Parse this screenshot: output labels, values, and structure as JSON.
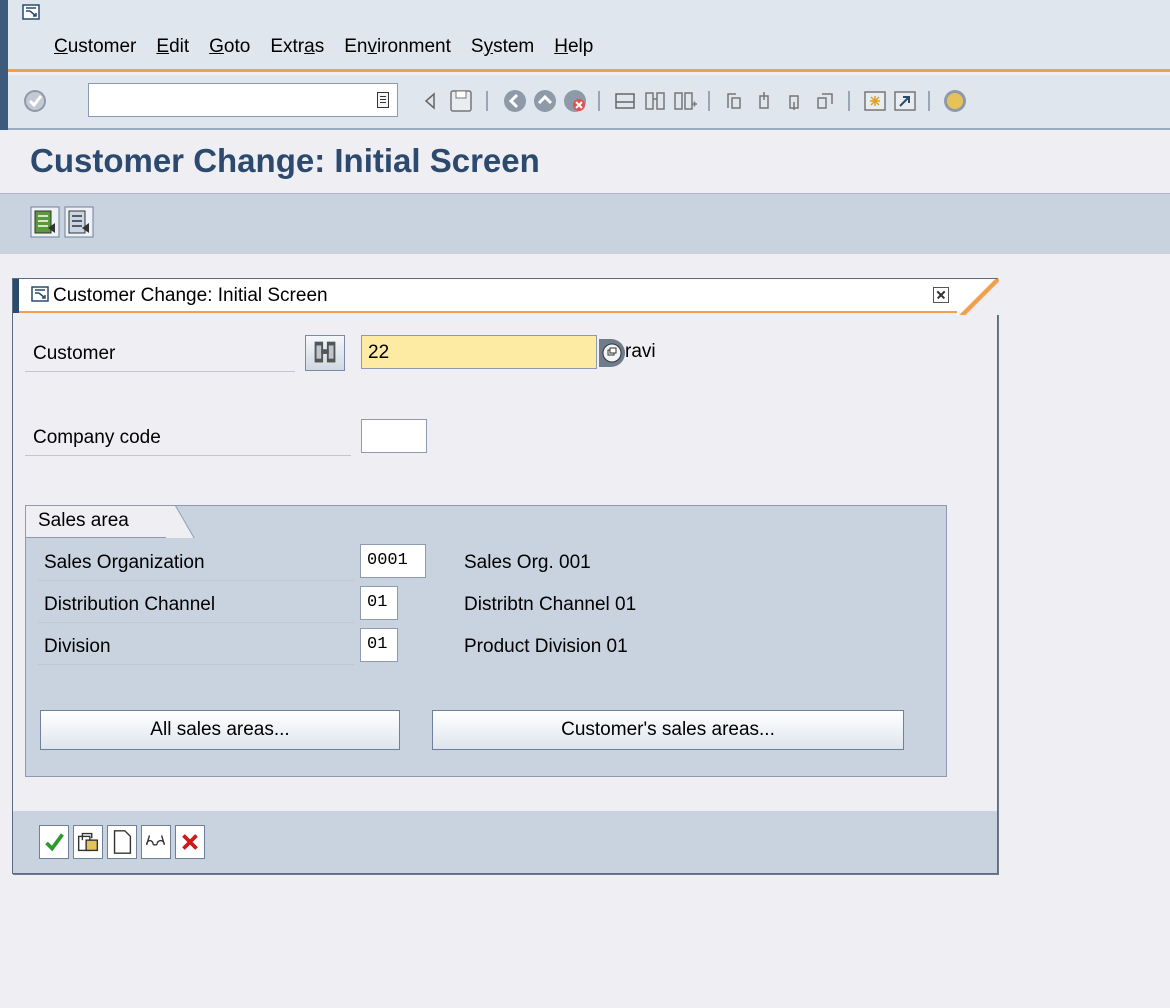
{
  "menubar": {
    "items": [
      {
        "label": "Customer",
        "ul": "C",
        "rest": "ustomer"
      },
      {
        "label": "Edit",
        "ul": "E",
        "rest": "dit"
      },
      {
        "label": "Goto",
        "ul": "G",
        "rest": "oto"
      },
      {
        "label": "Extras",
        "pre": "Extr",
        "ul": "a",
        "rest": "s"
      },
      {
        "label": "Environment",
        "pre": "En",
        "ul": "v",
        "rest": "ironment"
      },
      {
        "label": "System",
        "pre": "S",
        "ul": "y",
        "rest": "stem"
      },
      {
        "label": "Help",
        "ul": "H",
        "rest": "elp"
      }
    ]
  },
  "toolbar": {
    "command_value": "",
    "icons": [
      "enter-icon",
      "command-dropdown-icon",
      "back-arrow-icon",
      "save-icon",
      "back-icon",
      "exit-icon",
      "cancel-icon",
      "print-icon",
      "find-icon",
      "find-next-icon",
      "first-page-icon",
      "previous-page-icon",
      "next-page-icon",
      "last-page-icon",
      "create-session-icon",
      "shortcut-icon",
      "help-icon"
    ]
  },
  "page": {
    "title": "Customer Change: Initial Screen"
  },
  "dialog": {
    "title": "Customer Change: Initial Screen",
    "customer_label": "Customer",
    "customer_value": "22",
    "customer_desc": "ravi",
    "company_code_label": "Company code",
    "company_code_value": "",
    "sales_area": {
      "title": "Sales area",
      "rows": [
        {
          "label": "Sales Organization",
          "value": "0001",
          "desc": "Sales Org. 001"
        },
        {
          "label": "Distribution Channel",
          "value": "01",
          "desc": "Distribtn Channel 01"
        },
        {
          "label": "Division",
          "value": "01",
          "desc": "Product Division 01"
        }
      ],
      "all_sales_areas_btn": "All sales areas...",
      "customer_sales_areas_btn": "Customer's sales areas..."
    }
  },
  "colors": {
    "title": "#2b4a6e",
    "accent_orange": "#f0a04b",
    "required_field": "#fdeaa3",
    "group_bg": "#c9d3df"
  }
}
